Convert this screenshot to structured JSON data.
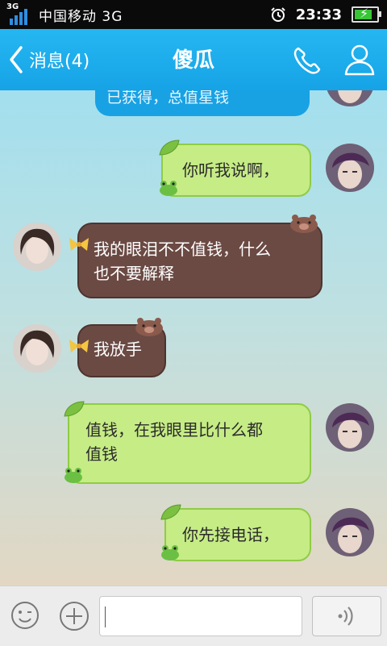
{
  "status_bar": {
    "network": "3G",
    "carrier": "中国移动 3G",
    "time": "23:33"
  },
  "header": {
    "back_label": "消息(4)",
    "title": "傻瓜"
  },
  "messages": [
    {
      "side": "right",
      "style": "blue",
      "text": "已获得，总值星钱"
    },
    {
      "side": "right",
      "style": "green",
      "text": "你听我说啊，"
    },
    {
      "side": "left",
      "style": "brown",
      "lines": [
        "我的眼泪不不值钱，什么",
        "也不要解释"
      ]
    },
    {
      "side": "left",
      "style": "brown",
      "text": "我放手"
    },
    {
      "side": "right",
      "style": "green",
      "lines": [
        "值钱，在我眼里比什么都",
        "值钱"
      ]
    },
    {
      "side": "right",
      "style": "green",
      "text": "你先接电话，"
    }
  ],
  "input_bar": {
    "text_value": "",
    "placeholder": ""
  },
  "colors": {
    "header": "#16a3e6",
    "green_bubble": "#c6ec86",
    "brown_bubble": "#6b4a44",
    "blue_bubble": "#18a2e4"
  },
  "icons": [
    "signal-icon",
    "alarm-icon",
    "battery-icon",
    "back-chevron-icon",
    "phone-icon",
    "profile-icon",
    "emoji-icon",
    "plus-icon",
    "voice-icon"
  ]
}
